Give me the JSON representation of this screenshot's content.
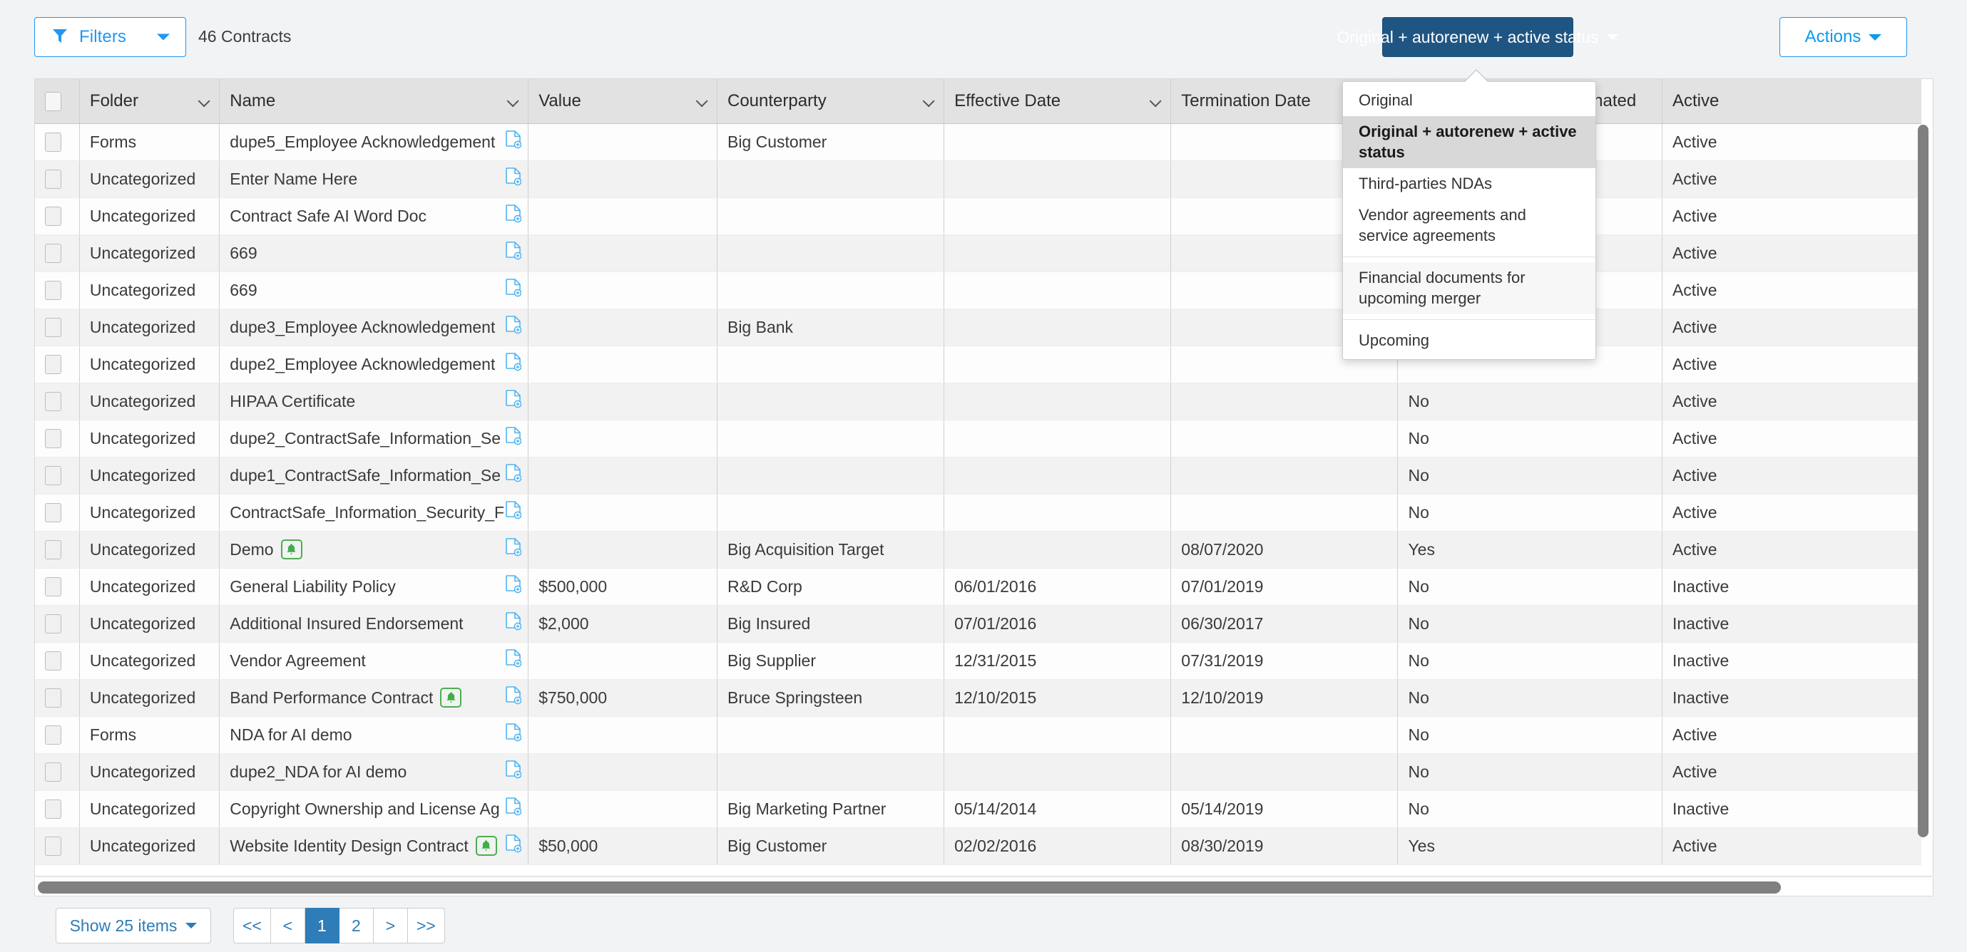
{
  "toolbar": {
    "filters_label": "Filters",
    "contract_count": "46 Contracts",
    "saved_search_label": "Original + autorenew + active status",
    "actions_label": "Actions"
  },
  "dropdown": {
    "items": [
      "Original",
      "Original + autorenew + active status",
      "Third-parties NDAs",
      "Vendor agreements and service agreements",
      "Financial documents for upcoming merger",
      "Upcoming"
    ],
    "selected": "Original + autorenew + active status"
  },
  "table": {
    "columns": [
      "Folder",
      "Name",
      "Value",
      "Counterparty",
      "Effective Date",
      "Termination Date",
      "Auto Renew If Not Terminated",
      "Active"
    ],
    "rows": [
      {
        "folder": "Forms",
        "name": "dupe5_Employee Acknowledgement",
        "bell": false,
        "value": "",
        "counterparty": "Big Customer",
        "effective": "",
        "termination": "",
        "autorenew": "",
        "active": "Active"
      },
      {
        "folder": "Uncategorized",
        "name": "Enter Name Here",
        "bell": false,
        "value": "",
        "counterparty": "",
        "effective": "",
        "termination": "",
        "autorenew": "",
        "active": "Active"
      },
      {
        "folder": "Uncategorized",
        "name": "Contract Safe AI Word Doc",
        "bell": false,
        "value": "",
        "counterparty": "",
        "effective": "",
        "termination": "",
        "autorenew": "",
        "active": "Active"
      },
      {
        "folder": "Uncategorized",
        "name": "669",
        "bell": false,
        "value": "",
        "counterparty": "",
        "effective": "",
        "termination": "",
        "autorenew": "",
        "active": "Active"
      },
      {
        "folder": "Uncategorized",
        "name": "669",
        "bell": false,
        "value": "",
        "counterparty": "",
        "effective": "",
        "termination": "",
        "autorenew": "",
        "active": "Active"
      },
      {
        "folder": "Uncategorized",
        "name": "dupe3_Employee Acknowledgement",
        "bell": false,
        "value": "",
        "counterparty": "Big Bank",
        "effective": "",
        "termination": "",
        "autorenew": "",
        "active": "Active"
      },
      {
        "folder": "Uncategorized",
        "name": "dupe2_Employee Acknowledgement",
        "bell": false,
        "value": "",
        "counterparty": "",
        "effective": "",
        "termination": "",
        "autorenew": "",
        "active": "Active"
      },
      {
        "folder": "Uncategorized",
        "name": "HIPAA Certificate",
        "bell": false,
        "value": "",
        "counterparty": "",
        "effective": "",
        "termination": "",
        "autorenew": "No",
        "active": "Active"
      },
      {
        "folder": "Uncategorized",
        "name": "dupe2_ContractSafe_Information_Se",
        "bell": false,
        "value": "",
        "counterparty": "",
        "effective": "",
        "termination": "",
        "autorenew": "No",
        "active": "Active"
      },
      {
        "folder": "Uncategorized",
        "name": "dupe1_ContractSafe_Information_Se",
        "bell": false,
        "value": "",
        "counterparty": "",
        "effective": "",
        "termination": "",
        "autorenew": "No",
        "active": "Active"
      },
      {
        "folder": "Uncategorized",
        "name": "ContractSafe_Information_Security_F",
        "bell": false,
        "value": "",
        "counterparty": "",
        "effective": "",
        "termination": "",
        "autorenew": "No",
        "active": "Active"
      },
      {
        "folder": "Uncategorized",
        "name": "Demo",
        "bell": true,
        "value": "",
        "counterparty": "Big Acquisition Target",
        "effective": "",
        "termination": "08/07/2020",
        "autorenew": "Yes",
        "active": "Active"
      },
      {
        "folder": "Uncategorized",
        "name": "General Liability Policy",
        "bell": false,
        "value": "$500,000",
        "counterparty": "R&D Corp",
        "effective": "06/01/2016",
        "termination": "07/01/2019",
        "autorenew": "No",
        "active": "Inactive"
      },
      {
        "folder": "Uncategorized",
        "name": "Additional Insured Endorsement",
        "bell": false,
        "value": "$2,000",
        "counterparty": "Big Insured",
        "effective": "07/01/2016",
        "termination": "06/30/2017",
        "autorenew": "No",
        "active": "Inactive"
      },
      {
        "folder": "Uncategorized",
        "name": "Vendor Agreement",
        "bell": false,
        "value": "",
        "counterparty": "Big Supplier",
        "effective": "12/31/2015",
        "termination": "07/31/2019",
        "autorenew": "No",
        "active": "Inactive"
      },
      {
        "folder": "Uncategorized",
        "name": "Band Performance Contract",
        "bell": true,
        "value": "$750,000",
        "counterparty": "Bruce Springsteen",
        "effective": "12/10/2015",
        "termination": "12/10/2019",
        "autorenew": "No",
        "active": "Inactive"
      },
      {
        "folder": "Forms",
        "name": "NDA for AI demo",
        "bell": false,
        "value": "",
        "counterparty": "",
        "effective": "",
        "termination": "",
        "autorenew": "No",
        "active": "Active"
      },
      {
        "folder": "Uncategorized",
        "name": "dupe2_NDA for AI demo",
        "bell": false,
        "value": "",
        "counterparty": "",
        "effective": "",
        "termination": "",
        "autorenew": "No",
        "active": "Active"
      },
      {
        "folder": "Uncategorized",
        "name": "Copyright Ownership and License Ag",
        "bell": false,
        "value": "",
        "counterparty": "Big Marketing Partner",
        "effective": "05/14/2014",
        "termination": "05/14/2019",
        "autorenew": "No",
        "active": "Inactive"
      },
      {
        "folder": "Uncategorized",
        "name": "Website Identity Design Contract",
        "bell": true,
        "value": "$50,000",
        "counterparty": "Big Customer",
        "effective": "02/02/2016",
        "termination": "08/30/2019",
        "autorenew": "Yes",
        "active": "Active"
      }
    ]
  },
  "footer": {
    "show_items_label": "Show 25 items",
    "pages": [
      "<<",
      "<",
      "1",
      "2",
      ">",
      ">>"
    ],
    "current_page": "1"
  },
  "colors": {
    "accent_blue": "#2196f3",
    "dark_blue": "#1f5582",
    "green": "#4caf50",
    "header_gray": "#e2e2e2"
  }
}
